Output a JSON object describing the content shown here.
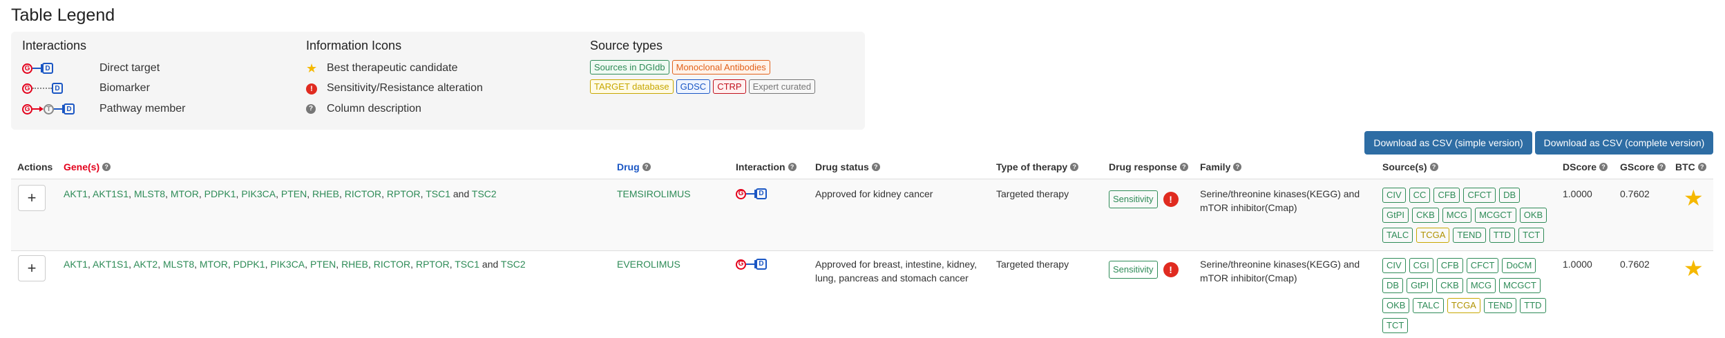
{
  "title": "Table Legend",
  "legend": {
    "interactions": {
      "heading": "Interactions",
      "items": [
        "Direct target",
        "Biomarker",
        "Pathway member"
      ]
    },
    "info_icons": {
      "heading": "Information Icons",
      "items": [
        "Best therapeutic candidate",
        "Sensitivity/Resistance alteration",
        "Column description"
      ]
    },
    "source_types": {
      "heading": "Source types",
      "row1": [
        {
          "label": "Sources in DGIdb",
          "color": "#2e8b57",
          "bg": "#f0faf3"
        },
        {
          "label": "Monoclonal Antibodies",
          "color": "#e2611a",
          "bg": "#fff3ea"
        }
      ],
      "row2": [
        {
          "label": "TARGET database",
          "color": "#c7a700",
          "bg": "#fffbe6"
        },
        {
          "label": "GDSC",
          "color": "#1a56c4",
          "bg": "#eef4ff"
        },
        {
          "label": "CTRP",
          "color": "#c0101c",
          "bg": "#fff0f0"
        },
        {
          "label": "Expert curated",
          "color": "#777777",
          "bg": "#f7f7f7"
        }
      ]
    }
  },
  "buttons": {
    "csv_simple": "Download as CSV (simple version)",
    "csv_complete": "Download as CSV (complete version)"
  },
  "columns": {
    "actions": "Actions",
    "genes": "Gene(s)",
    "drug": "Drug",
    "interaction": "Interaction",
    "drug_status": "Drug status",
    "type_of_therapy": "Type of therapy",
    "drug_response": "Drug response",
    "family": "Family",
    "sources": "Source(s)",
    "dscore": "DScore",
    "gscore": "GScore",
    "btc": "BTC"
  },
  "rows": [
    {
      "genes": [
        "AKT1",
        "AKT1S1",
        "MLST8",
        "MTOR",
        "PDPK1",
        "PIK3CA",
        "PTEN",
        "RHEB",
        "RICTOR",
        "RPTOR",
        "TSC1"
      ],
      "genes_last": "TSC2",
      "and_word": "and",
      "drug": "TEMSIROLIMUS",
      "status": "Approved for kidney cancer",
      "therapy": "Targeted therapy",
      "response": "Sensitivity",
      "family": "Serine/threonine kinases(KEGG) and mTOR inhibitor(Cmap)",
      "sources": [
        "CIV",
        "CC",
        "CFB",
        "CFCT",
        "DB",
        "GtPI",
        "CKB",
        "MCG",
        "MCGCT",
        "OKB",
        "TALC",
        "TCGA",
        "TEND",
        "TTD",
        "TCT"
      ],
      "dscore": "1.0000",
      "gscore": "0.7602"
    },
    {
      "genes": [
        "AKT1",
        "AKT1S1",
        "AKT2",
        "MLST8",
        "MTOR",
        "PDPK1",
        "PIK3CA",
        "PTEN",
        "RHEB",
        "RICTOR",
        "RPTOR",
        "TSC1"
      ],
      "genes_last": "TSC2",
      "and_word": "and",
      "drug": "EVEROLIMUS",
      "status": "Approved for breast, intestine, kidney, lung, pancreas and stomach cancer",
      "therapy": "Targeted therapy",
      "response": "Sensitivity",
      "family": "Serine/threonine kinases(KEGG) and mTOR inhibitor(Cmap)",
      "sources": [
        "CIV",
        "CGI",
        "CFB",
        "CFCT",
        "DoCM",
        "DB",
        "GtPI",
        "CKB",
        "MCG",
        "MCGCT",
        "OKB",
        "TALC",
        "TCGA",
        "TEND",
        "TTD",
        "TCT"
      ],
      "dscore": "1.0000",
      "gscore": "0.7602"
    }
  ],
  "glyphs": {
    "G": "G",
    "D": "D",
    "T": "T",
    "excl": "!",
    "qm": "?",
    "plus": "+",
    "star": "★"
  },
  "colors": {
    "gene_header": "#e3001b",
    "drug_header": "#1a56c4",
    "link_green": "#2e8b57",
    "button_blue": "#2e6da4"
  }
}
